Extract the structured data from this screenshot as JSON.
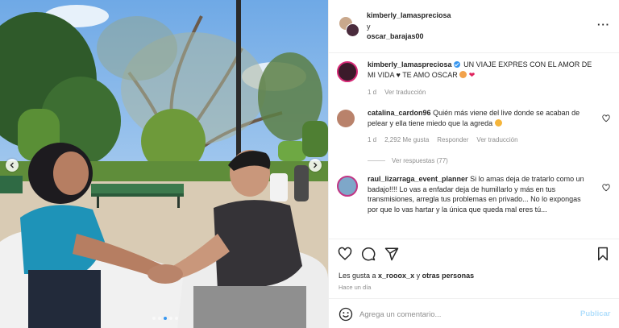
{
  "header": {
    "user1": "kimberly_lamaspreciosa",
    "conjunction": "y",
    "user2": "oscar_barajas00",
    "more_icon": "more-horizontal-icon"
  },
  "caption": {
    "username": "kimberly_lamaspreciosa",
    "text": "UN VIAJE EXPRES CON EL AMOR DE MI VIDA ♥ TE AMO OSCAR",
    "time": "1 d",
    "translate": "Ver traducción"
  },
  "comments": [
    {
      "username": "catalina_cardon96",
      "text": "Quién más viene del live donde se acaban de pelear y ella tiene miedo que la agreda",
      "time": "1 d",
      "likes": "2,292 Me gusta",
      "reply": "Responder",
      "translate": "Ver traducción",
      "view_replies": "Ver respuestas (77)"
    },
    {
      "username": "raul_lizarraga_event_planner",
      "text": "Si lo amas deja de tratarlo como un badajo!!!! Lo vas a enfadar deja de humillarlo y más en tus transmisiones, arregla tus problemas en privado... No lo expongas por que lo vas hartar y la única que queda mal eres tú..."
    }
  ],
  "likes": {
    "prefix": "Les gusta a ",
    "user": "x_rooox_x",
    "middle": " y ",
    "others": "otras personas"
  },
  "timestamp": "Hace un día",
  "composer": {
    "placeholder": "Agrega un comentario...",
    "publish": "Publicar"
  },
  "colors": {
    "accent": "#3897f0",
    "publish_disabled": "#b2dffc",
    "muted": "#8e8e8e"
  }
}
